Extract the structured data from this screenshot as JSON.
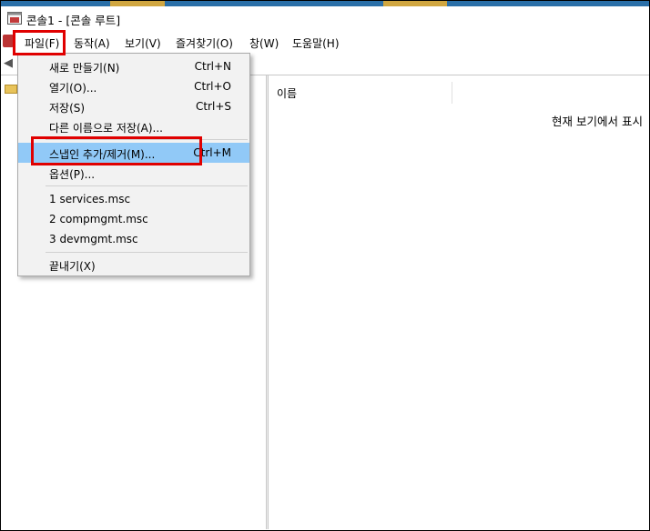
{
  "window": {
    "title": "콘솔1 - [콘솔 루트]"
  },
  "menubar": {
    "items": [
      "파일(F)",
      "동작(A)",
      "보기(V)",
      "즐겨찾기(O)",
      "창(W)",
      "도움말(H)"
    ]
  },
  "file_menu": {
    "items": [
      {
        "label": "새로 만들기(N)",
        "shortcut": "Ctrl+N"
      },
      {
        "label": "열기(O)...",
        "shortcut": "Ctrl+O"
      },
      {
        "label": "저장(S)",
        "shortcut": "Ctrl+S"
      },
      {
        "label": "다른 이름으로 저장(A)...",
        "shortcut": ""
      },
      {
        "label": "스냅인 추가/제거(M)...",
        "shortcut": "Ctrl+M"
      },
      {
        "label": "옵션(P)...",
        "shortcut": ""
      },
      {
        "label": "1 services.msc",
        "shortcut": ""
      },
      {
        "label": "2 compmgmt.msc",
        "shortcut": ""
      },
      {
        "label": "3 devmgmt.msc",
        "shortcut": ""
      },
      {
        "label": "끝내기(X)",
        "shortcut": ""
      }
    ]
  },
  "content": {
    "column_header": "이름",
    "empty_message": "현재 보기에서 표시"
  },
  "colors": {
    "highlight": "#91c9f7",
    "annotation_red": "#e00000"
  }
}
